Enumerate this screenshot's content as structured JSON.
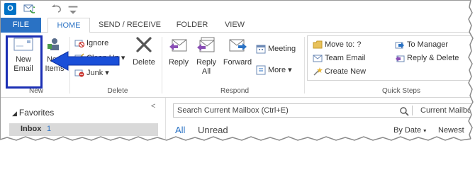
{
  "titlebar": {
    "logo_letter": "O"
  },
  "tabs": {
    "file": "FILE",
    "home": "HOME",
    "send_receive": "SEND / RECEIVE",
    "folder": "FOLDER",
    "view": "VIEW"
  },
  "ribbon": {
    "new_group": {
      "label": "New",
      "new_email_line1": "New",
      "new_email_line2": "Email",
      "new_items_line1": "New",
      "new_items_line2": "Items"
    },
    "delete_group": {
      "label": "Delete",
      "ignore": "Ignore",
      "cleanup": "Clean Up",
      "junk": "Junk",
      "delete": "Delete"
    },
    "respond_group": {
      "label": "Respond",
      "reply": "Reply",
      "reply_all_line1": "Reply",
      "reply_all_line2": "All",
      "forward": "Forward",
      "meeting": "Meeting",
      "more": "More"
    },
    "quick_steps_group": {
      "label": "Quick Steps",
      "move_to": "Move to: ?",
      "team_email": "Team Email",
      "create_new": "Create New",
      "to_manager": "To Manager",
      "reply_delete": "Reply & Delete"
    }
  },
  "folder_pane": {
    "favorites": "Favorites",
    "inbox_label": "Inbox",
    "inbox_count": "1"
  },
  "search": {
    "placeholder": "Search Current Mailbox (Ctrl+E)",
    "scope": "Current Mailbo"
  },
  "message_list": {
    "filter_all": "All",
    "filter_unread": "Unread",
    "sort_by": "By Date",
    "order": "Newest"
  },
  "colors": {
    "accent": "#2a72c4",
    "highlight": "#1b2fb4",
    "arrow": "#1a4fd8"
  }
}
